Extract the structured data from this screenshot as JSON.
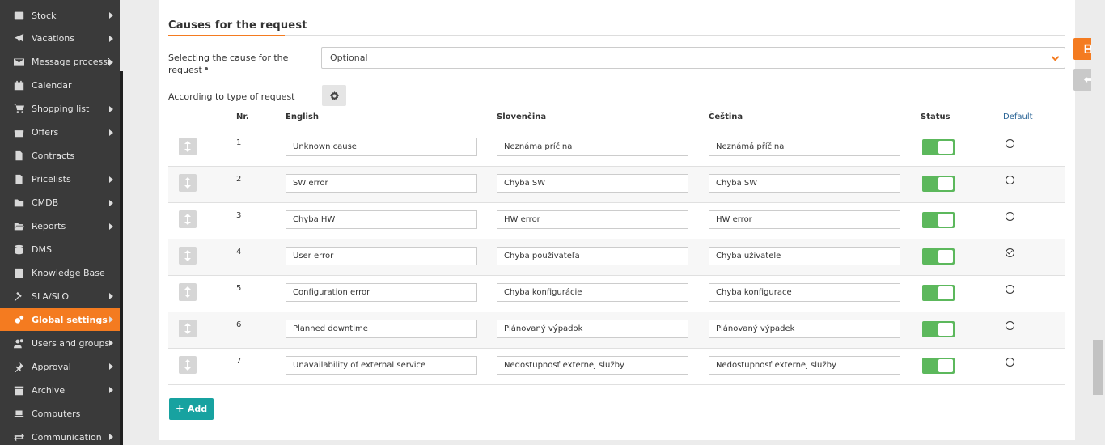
{
  "sidebar": {
    "items": [
      {
        "label": "Stock",
        "icon": "box-icon",
        "arrow": true
      },
      {
        "label": "Vacations",
        "icon": "plane-icon",
        "arrow": true
      },
      {
        "label": "Message processi...",
        "icon": "envelope-icon",
        "arrow": true
      },
      {
        "label": "Calendar",
        "icon": "calendar-icon",
        "arrow": false
      },
      {
        "label": "Shopping list",
        "icon": "cart-icon",
        "arrow": true
      },
      {
        "label": "Offers",
        "icon": "gift-icon",
        "arrow": true
      },
      {
        "label": "Contracts",
        "icon": "document-icon",
        "arrow": false
      },
      {
        "label": "Pricelists",
        "icon": "document-list-icon",
        "arrow": true
      },
      {
        "label": "CMDB",
        "icon": "folder-icon",
        "arrow": true
      },
      {
        "label": "Reports",
        "icon": "folder-open-icon",
        "arrow": true
      },
      {
        "label": "DMS",
        "icon": "database-icon",
        "arrow": false
      },
      {
        "label": "Knowledge Base",
        "icon": "book-icon",
        "arrow": false
      },
      {
        "label": "SLA/SLO",
        "icon": "gavel-icon",
        "arrow": true
      },
      {
        "label": "Global settings",
        "icon": "cogs-icon",
        "arrow": true,
        "active": true
      },
      {
        "label": "Users and groups",
        "icon": "users-icon",
        "arrow": true
      },
      {
        "label": "Approval",
        "icon": "thumbtack-icon",
        "arrow": true
      },
      {
        "label": "Archive",
        "icon": "archive-icon",
        "arrow": true
      },
      {
        "label": "Computers",
        "icon": "laptop-icon",
        "arrow": false
      },
      {
        "label": "Communication",
        "icon": "exchange-icon",
        "arrow": true
      }
    ]
  },
  "section": {
    "title": "Causes for the request"
  },
  "form": {
    "cause_label": "Selecting the cause for the request",
    "cause_value": "Optional",
    "type_label": "According to type of request"
  },
  "table": {
    "headers": {
      "nr": "Nr.",
      "english": "English",
      "slovak": "Slovenčina",
      "czech": "Čeština",
      "status": "Status",
      "default": "Default"
    },
    "rows": [
      {
        "nr": "1",
        "english": "Unknown cause",
        "slovak": "Neznáma príčina",
        "czech": "Neznámá příčina",
        "status": true,
        "default": false
      },
      {
        "nr": "2",
        "english": "SW error",
        "slovak": "Chyba SW",
        "czech": "Chyba SW",
        "status": true,
        "default": false
      },
      {
        "nr": "3",
        "english": "Chyba HW",
        "slovak": "HW error",
        "czech": "HW error",
        "status": true,
        "default": false
      },
      {
        "nr": "4",
        "english": "User error",
        "slovak": "Chyba používateľa",
        "czech": "Chyba uživatele",
        "status": true,
        "default": true
      },
      {
        "nr": "5",
        "english": "Configuration error",
        "slovak": "Chyba konfigurácie",
        "czech": "Chyba konfigurace",
        "status": true,
        "default": false
      },
      {
        "nr": "6",
        "english": "Planned downtime",
        "slovak": "Plánovaný výpadok",
        "czech": "Plánovaný výpadek",
        "status": true,
        "default": false
      },
      {
        "nr": "7",
        "english": "Unavailability of external service",
        "slovak": "Nedostupnosť externej služby",
        "czech": "Nedostupnosť externej služby",
        "status": true,
        "default": false
      }
    ]
  },
  "actions": {
    "add_label": "Add"
  },
  "colors": {
    "accent": "#f47b20",
    "toggle_on": "#5cb85c",
    "add_button": "#17a2a0"
  }
}
